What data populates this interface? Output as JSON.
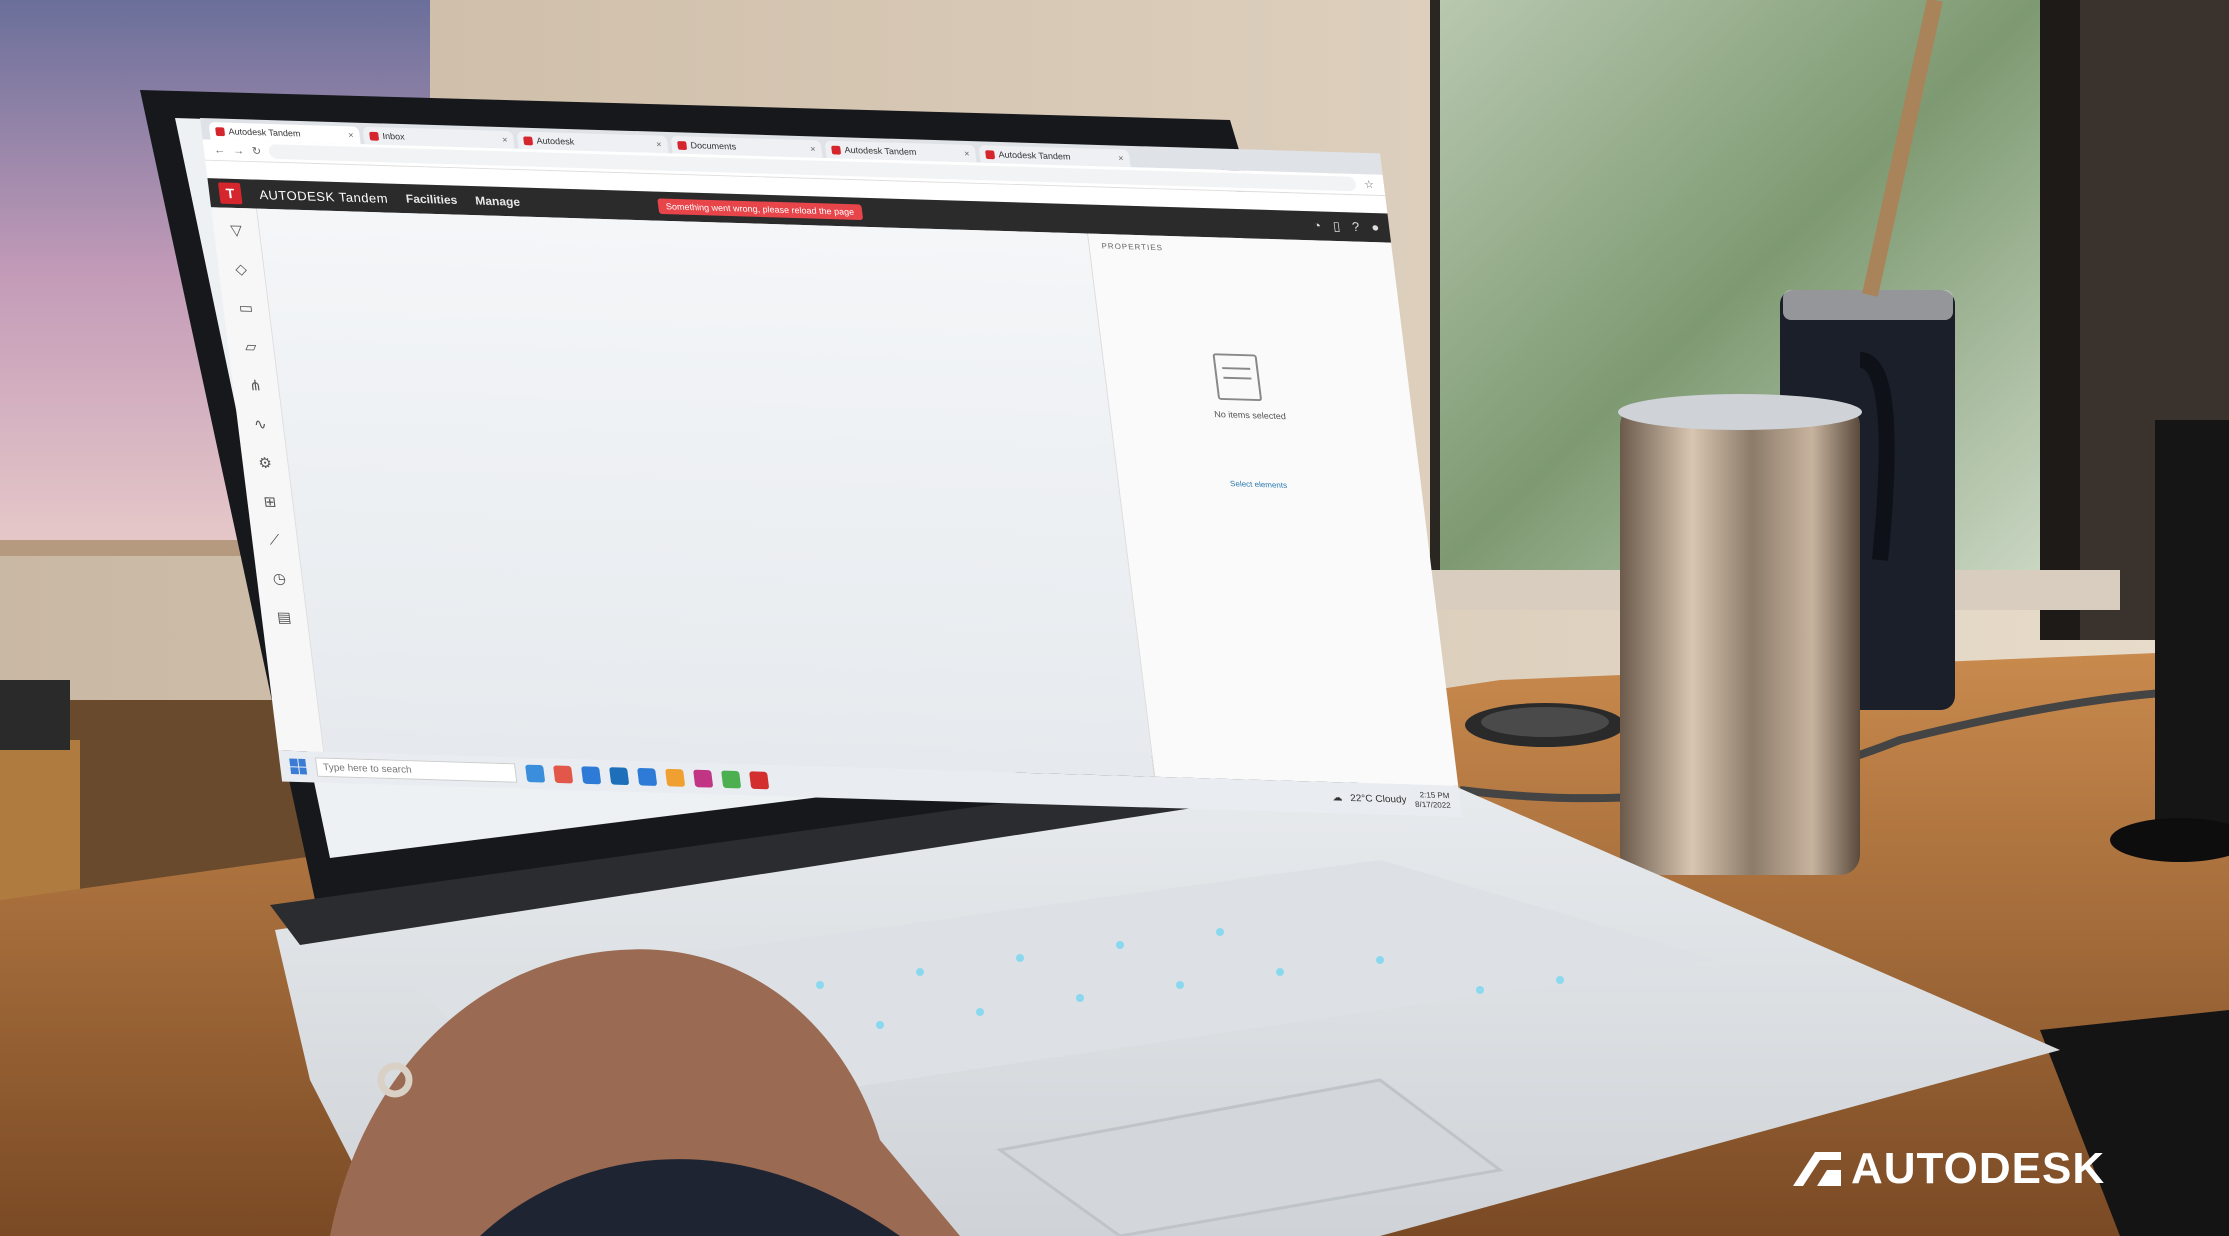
{
  "browser": {
    "tabs": [
      {
        "label": "Autodesk Tandem"
      },
      {
        "label": "Inbox"
      },
      {
        "label": "Autodesk"
      },
      {
        "label": "Documents"
      },
      {
        "label": "Autodesk Tandem"
      },
      {
        "label": "Autodesk Tandem"
      }
    ]
  },
  "app": {
    "brand": "AUTODESK",
    "product": "Tandem",
    "menu": [
      "Facilities",
      "Manage"
    ],
    "warning": "Something went wrong, please reload the page",
    "tools": [
      "filter-icon",
      "tag-icon",
      "layers-icon",
      "folder-icon",
      "tree-icon",
      "chart-icon",
      "settings-icon",
      "grid-icon",
      "trend-icon",
      "history-icon",
      "table-icon"
    ]
  },
  "properties": {
    "title": "PROPERTIES",
    "empty_message": "No items selected",
    "link_text": "Select elements"
  },
  "taskbar": {
    "search_placeholder": "Type here to search",
    "weather": "22°C Cloudy",
    "time": "2:15 PM",
    "date": "8/17/2022"
  },
  "watermark": {
    "wordmark": "AUTODESK"
  },
  "colors": {
    "autodesk_red": "#d6262d",
    "building_accent": "#1e9bc8",
    "app_bar": "#2b2b2b",
    "watermark": "#ffffff"
  }
}
